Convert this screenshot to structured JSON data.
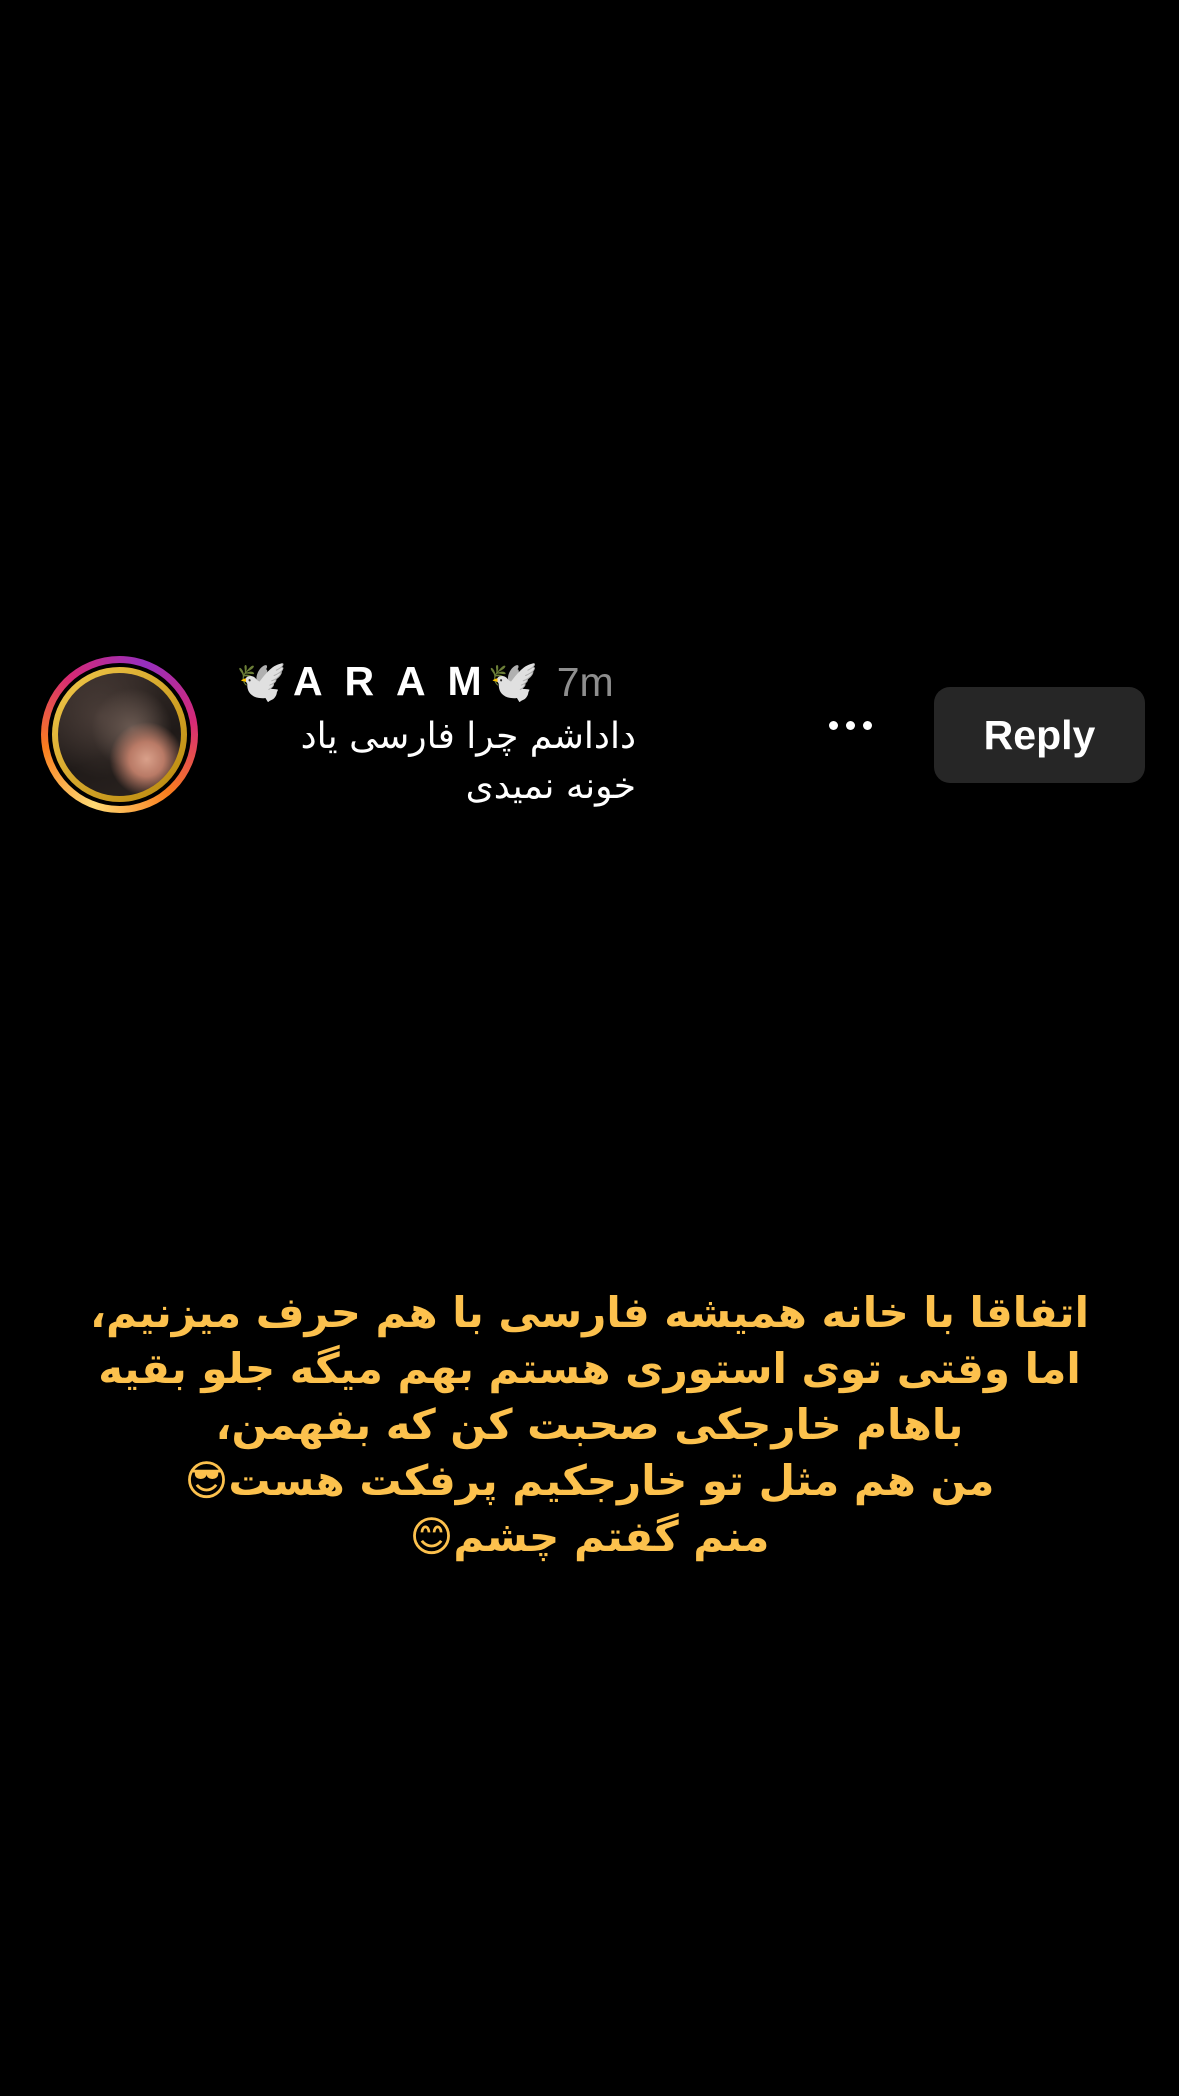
{
  "comment": {
    "username": "🕊️A R A M🕊️",
    "timestamp": "7m",
    "text": "داداشم چرا فارسی یاد خونه نمیدی",
    "avatar_icon": "profile-photo-with-story-ring",
    "more_icon": "more-horizontal-icon",
    "reply_label": "Reply"
  },
  "story": {
    "lines": [
      "اتفاقا با خانه همیشه فارسی با هم حرف میزنیم،",
      "اما وقتی توی استوری هستم بهم میگه جلو بقیه",
      "باهام خارجکی صحبت کن که بفهمن،",
      "من هم مثل تو خارجکیم پرفکت هست😎",
      "منم گفتم چشم😊"
    ],
    "text_color": "#fcc14d"
  },
  "colors": {
    "background": "#000000",
    "reply_button_bg": "#262626",
    "timestamp": "#8e8e8e"
  }
}
